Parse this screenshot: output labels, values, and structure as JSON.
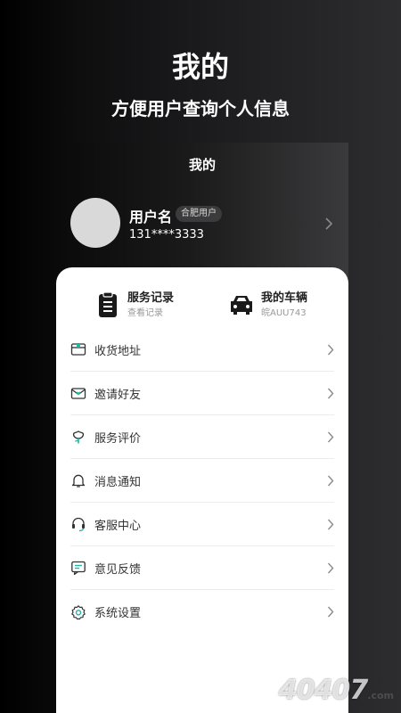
{
  "promo": {
    "title": "我的",
    "subtitle": "方便用户查询个人信息"
  },
  "screen": {
    "title": "我的"
  },
  "profile": {
    "username": "用户名",
    "city_badge": "合肥用户",
    "phone": "131****3333"
  },
  "quick_actions": [
    {
      "title": "服务记录",
      "subtitle": "查看记录",
      "icon": "clipboard-icon"
    },
    {
      "title": "我的车辆",
      "subtitle": "皖AUU743",
      "icon": "car-icon"
    }
  ],
  "menu": [
    {
      "label": "收货地址",
      "icon": "address-box-icon"
    },
    {
      "label": "邀请好友",
      "icon": "invite-envelope-icon"
    },
    {
      "label": "服务评价",
      "icon": "flower-rating-icon"
    },
    {
      "label": "消息通知",
      "icon": "bell-icon"
    },
    {
      "label": "客服中心",
      "icon": "headset-icon"
    },
    {
      "label": "意见反馈",
      "icon": "feedback-icon"
    },
    {
      "label": "系统设置",
      "icon": "settings-gear-icon"
    }
  ],
  "watermark": {
    "text": "4040",
    "text2": "7",
    "suffix": ".com"
  },
  "colors": {
    "accent": "#1fb8a8",
    "text_dark": "#222222",
    "text_muted": "#999999"
  }
}
